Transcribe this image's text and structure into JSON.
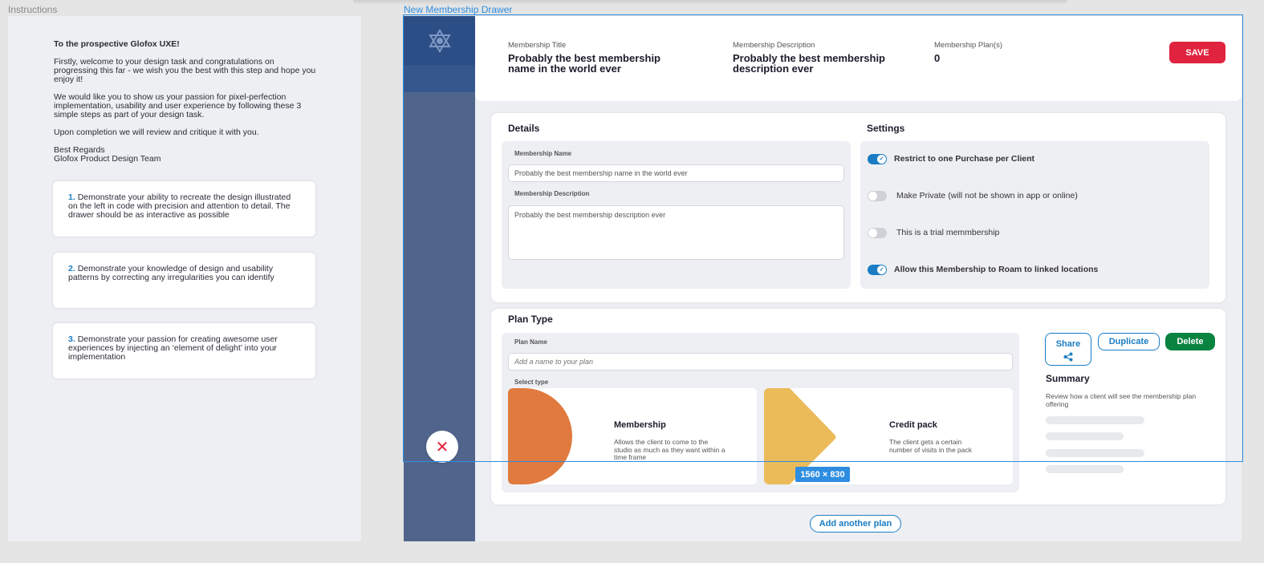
{
  "labels": {
    "instructions": "Instructions",
    "drawer": "New Membership Drawer"
  },
  "instructions": {
    "greeting": "To the prospective Glofox UXE!",
    "para1": "Firstly, welcome to your design task and congratulations on progressing this far - we wish you the best with this step and hope you enjoy it!",
    "para2": "We would like you to show us your passion for pixel-perfection implementation, usability and user experience by following these 3 simple steps as part of your design task.",
    "para3": "Upon completion we will review and critique it with you.",
    "signoff1": "Best Regards",
    "signoff2": "Glofox Product Design Team",
    "steps": [
      {
        "num": "1.",
        "text": "Demonstrate your ability to recreate the design illustrated on the left in code with precision and attention to detail. The drawer should be as interactive as possible"
      },
      {
        "num": "2.",
        "text": "Demonstrate your knowledge of design and usability patterns by correcting any irregularities you can identify"
      },
      {
        "num": "3.",
        "text": "Demonstrate your passion for creating awesome user experiences by injecting an ‘element of delight’ into your implementation"
      }
    ]
  },
  "header": {
    "title_label": "Membership Title",
    "title_value": "Probably the best membership name in the world ever",
    "desc_label": "Membership Description",
    "desc_value": "Probably the best membership description ever",
    "plans_label": "Membership Plan(s)",
    "plans_value": "0",
    "save_label": "SAVE"
  },
  "details": {
    "title": "Details",
    "name_label": "Membership Name",
    "name_value": "Probably the best membership name in the world ever",
    "desc_label": "Membership Description",
    "desc_value": "Probably the best membership description ever"
  },
  "settings": {
    "title": "Settings",
    "items": [
      {
        "label": "Restrict to one Purchase per Client",
        "on": true
      },
      {
        "label": "Make Private (will not be shown in app or online)",
        "on": false
      },
      {
        "label": "This is a trial memmbership",
        "on": false
      },
      {
        "label": "Allow this Membership to Roam to linked locations",
        "on": true
      }
    ]
  },
  "plan": {
    "title": "Plan Type",
    "name_label": "Plan Name",
    "name_placeholder": "Add a name to your plan",
    "select_label": "Select type",
    "types": [
      {
        "name": "Membership",
        "desc": "Allows the client to come to the studio as much as they want within a time frame",
        "color": "#e07a3e"
      },
      {
        "name": "Credit pack",
        "desc": "The client gets a certain number of visits in the pack",
        "color": "#ebbb5a"
      }
    ],
    "share_label": "Share",
    "duplicate_label": "Duplicate",
    "delete_label": "Delete",
    "summary_title": "Summary",
    "summary_desc": "Review how a client will see the membership plan offering",
    "add_plan_label": "Add another plan"
  },
  "overlay": {
    "size_badge": "1560 × 830"
  },
  "colors": {
    "accent": "#1a7dc4",
    "save": "#e0233e",
    "delete": "#0a8341",
    "sidebar": "#51658c"
  }
}
